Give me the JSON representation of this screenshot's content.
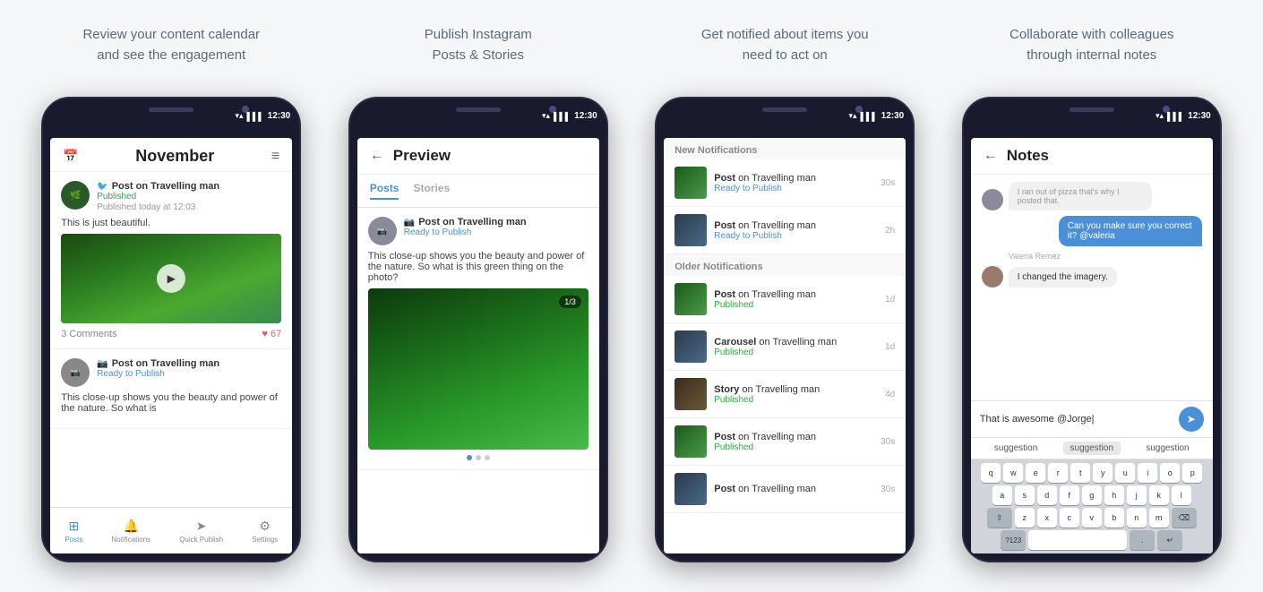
{
  "features": [
    {
      "id": "calendar",
      "title": "Review your content calendar\nand see the engagement"
    },
    {
      "id": "publish",
      "title": "Publish Instagram\nPosts & Stories"
    },
    {
      "id": "notifications",
      "title": "Get notified about items you\nneed to act on"
    },
    {
      "id": "notes",
      "title": "Collaborate with colleagues\nthrough internal notes"
    }
  ],
  "phone1": {
    "status_time": "12:30",
    "month": "November",
    "posts": [
      {
        "type": "Post on Travelling man",
        "status": "Published",
        "date": "Published today at 12:03",
        "text": "This is just beautiful.",
        "comments": "3 Comments",
        "likes": "67"
      },
      {
        "type": "Post on Travelling man",
        "status": "Ready to Publish",
        "text": "This close-up shows you the beauty and power of the nature. So what is"
      }
    ],
    "nav": [
      "Posts",
      "Notifications",
      "Quick Publish",
      "Settings"
    ]
  },
  "phone2": {
    "status_time": "12:30",
    "title": "Preview",
    "tabs": [
      "Posts",
      "Stories"
    ],
    "post": {
      "type": "Post on Travelling man",
      "status": "Ready to Publish",
      "text": "This close-up shows you the beauty and power of the nature. So what is this green thing on the photo?",
      "carousel_badge": "1/3"
    }
  },
  "phone3": {
    "status_time": "12:30",
    "new_section": "New Notifications",
    "older_section": "Older Notifications",
    "notifications": [
      {
        "type": "Post",
        "place": "on Travelling man",
        "status": "Ready to Publish",
        "time": "30s",
        "new": true
      },
      {
        "type": "Post",
        "place": "on Travelling man",
        "status": "Ready to Publish",
        "time": "2h",
        "new": true
      },
      {
        "type": "Post",
        "place": "on Travelling man",
        "status": "Published",
        "time": "1d",
        "new": false
      },
      {
        "type": "Carousel",
        "place": "on Travelling man",
        "status": "Published",
        "time": "1d",
        "new": false
      },
      {
        "type": "Story",
        "place": "on Travelling man",
        "status": "Published",
        "time": "4d",
        "new": false
      },
      {
        "type": "Post",
        "place": "on Travelling man",
        "status": "Published",
        "time": "30s",
        "new": false
      },
      {
        "type": "Post",
        "place": "on Travelling man",
        "status": "",
        "time": "30s",
        "new": false
      }
    ]
  },
  "phone4": {
    "status_time": "12:30",
    "title": "Notes",
    "messages": [
      {
        "from": "other",
        "text": "I ran out of pizza that's why I posted that.",
        "avatar": true
      },
      {
        "from": "me",
        "text": "Can you make sure you correct it? @valeria"
      },
      {
        "from": "other",
        "name": "Valeria Remez",
        "text": "I changed the imagery.",
        "avatar": true
      },
      {
        "from": "typing",
        "text": "That is awesome @Jorge|"
      }
    ],
    "suggestions": [
      "suggestion",
      "suggestion",
      "suggestion"
    ],
    "keyboard_rows": [
      [
        "q",
        "w",
        "e",
        "r",
        "t",
        "y",
        "u",
        "i",
        "o",
        "p"
      ],
      [
        "a",
        "s",
        "d",
        "f",
        "g",
        "h",
        "j",
        "k",
        "l"
      ],
      [
        "⇧",
        "z",
        "x",
        "c",
        "v",
        "b",
        "n",
        "m",
        "⌫"
      ],
      [
        "?123",
        "space",
        ".",
        "↵"
      ]
    ]
  }
}
